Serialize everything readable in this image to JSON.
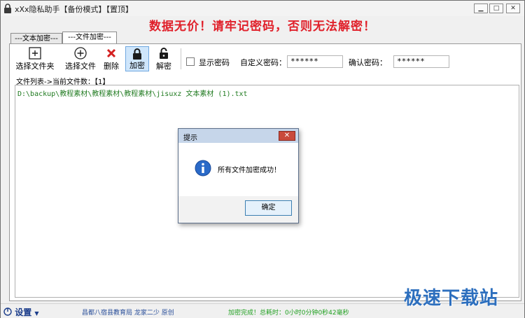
{
  "window": {
    "title": "xXx隐私助手【备份模式】【置顶】"
  },
  "slogan": "数据无价！请牢记密码，否则无法解密！",
  "tabs": [
    {
      "label": "---文本加密---"
    },
    {
      "label": "---文件加密---",
      "active": true
    }
  ],
  "toolbar": {
    "buttons": [
      {
        "label": "选择文件夹",
        "icon": "add-folder-icon"
      },
      {
        "label": "选择文件",
        "icon": "add-file-icon"
      },
      {
        "label": "删除",
        "icon": "delete-x-icon"
      },
      {
        "label": "加密",
        "icon": "lock-icon",
        "active": true
      },
      {
        "label": "解密",
        "icon": "unlock-icon"
      }
    ],
    "show_password_label": "显示密码",
    "show_password_checked": false,
    "custom_password_label": "自定义密码：",
    "custom_password_value": "******",
    "confirm_password_label": "确认密码：",
    "confirm_password_value": "******"
  },
  "file_list": {
    "count_label": "文件列表->当前文件数：【1】",
    "rows": [
      "D:\\backup\\教程素材\\教程素材\\教程素材\\jisuxz 文本素材 (1).txt"
    ]
  },
  "dialog": {
    "title": "提示",
    "close_label": "✕",
    "message": "所有文件加密成功！",
    "ok_label": "确定"
  },
  "statusbar": {
    "settings_label": "设置",
    "school_text": "昌都八宿县教育局 龙家二少 原创",
    "done_text": "加密完成！总耗时：0小时0分钟0秒42毫秒"
  },
  "watermark": "极速下载站",
  "colors": {
    "slogan": "#e0202a",
    "file_row": "#1f7a1f",
    "status_done": "#20a020",
    "dialog_title": "#c6d6ea"
  }
}
